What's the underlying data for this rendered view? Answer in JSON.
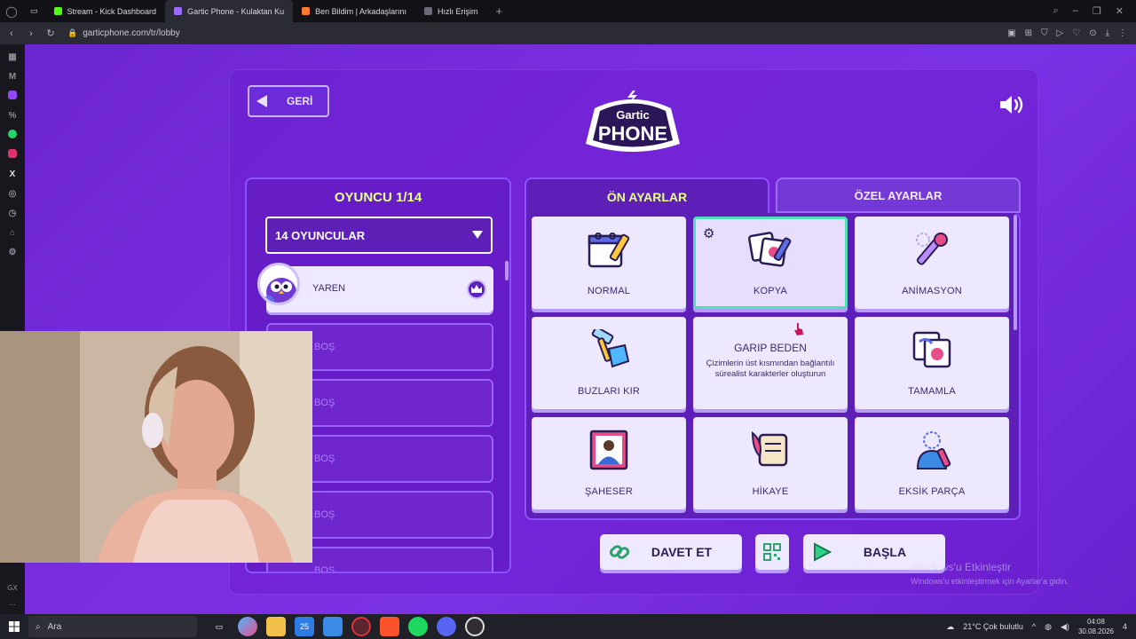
{
  "browser": {
    "tabs": [
      {
        "label": "Stream - Kick Dashboard",
        "color": "#53fc18"
      },
      {
        "label": "Gartic Phone - Kulaktan Ku",
        "color": "#9c6cff"
      },
      {
        "label": "Ben Bildim | Arkadaşlarını",
        "color": "#ff7a2f"
      },
      {
        "label": "Hızlı Erişim",
        "color": "#6a6a7a"
      }
    ],
    "url": "garticphone.com/tr/lobby"
  },
  "game": {
    "back_label": "GERİ",
    "logo_top": "Gartic",
    "logo_bottom": "PHONE",
    "players_title": "OYUNCU 1/14",
    "player_select": "14 OYUNCULAR",
    "players": [
      {
        "name": "YAREN",
        "host": true
      },
      {
        "name": "BOŞ"
      },
      {
        "name": "BOŞ"
      },
      {
        "name": "BOŞ"
      },
      {
        "name": "BOŞ"
      },
      {
        "name": "BOŞ"
      }
    ],
    "tabs": {
      "preset": "ÖN AYARLAR",
      "custom": "ÖZEL AYARLAR"
    },
    "modes": [
      {
        "label": "NORMAL",
        "icon": "notepad-pencil-icon"
      },
      {
        "label": "KOPYA",
        "icon": "copy-cards-icon",
        "selected": true
      },
      {
        "label": "ANİMASYON",
        "icon": "animation-brush-icon"
      },
      {
        "label": "BUZLARI KIR",
        "icon": "ice-hammer-icon"
      },
      {
        "label": "GARIP BEDEN",
        "description": "Çizimlerin üst kısmından bağlantılı sürealist karakterler oluşturun",
        "hover": true
      },
      {
        "label": "TAMAMLA",
        "icon": "complete-drawing-icon"
      },
      {
        "label": "ŞAHESER",
        "icon": "masterpiece-icon"
      },
      {
        "label": "HİKAYE",
        "icon": "story-scroll-icon"
      },
      {
        "label": "EKSİK PARÇA",
        "icon": "missing-piece-icon"
      }
    ],
    "invite_label": "DAVET ET",
    "start_label": "BAŞLA",
    "colors": {
      "accent_yellow": "#e6ff8a",
      "selected_border": "#4fe0b6",
      "background": "#7b2ee0"
    }
  },
  "windows": {
    "activate_title": "Windows'u Etkinleştir",
    "activate_sub": "Windows'u etkinleştirmek için Ayarlar'a gidin.",
    "search_placeholder": "Ara",
    "weather": "21°C  Çok bulutlu",
    "time": "04:08",
    "date": "30.08.2026",
    "badge": "25",
    "notifications": "4"
  }
}
